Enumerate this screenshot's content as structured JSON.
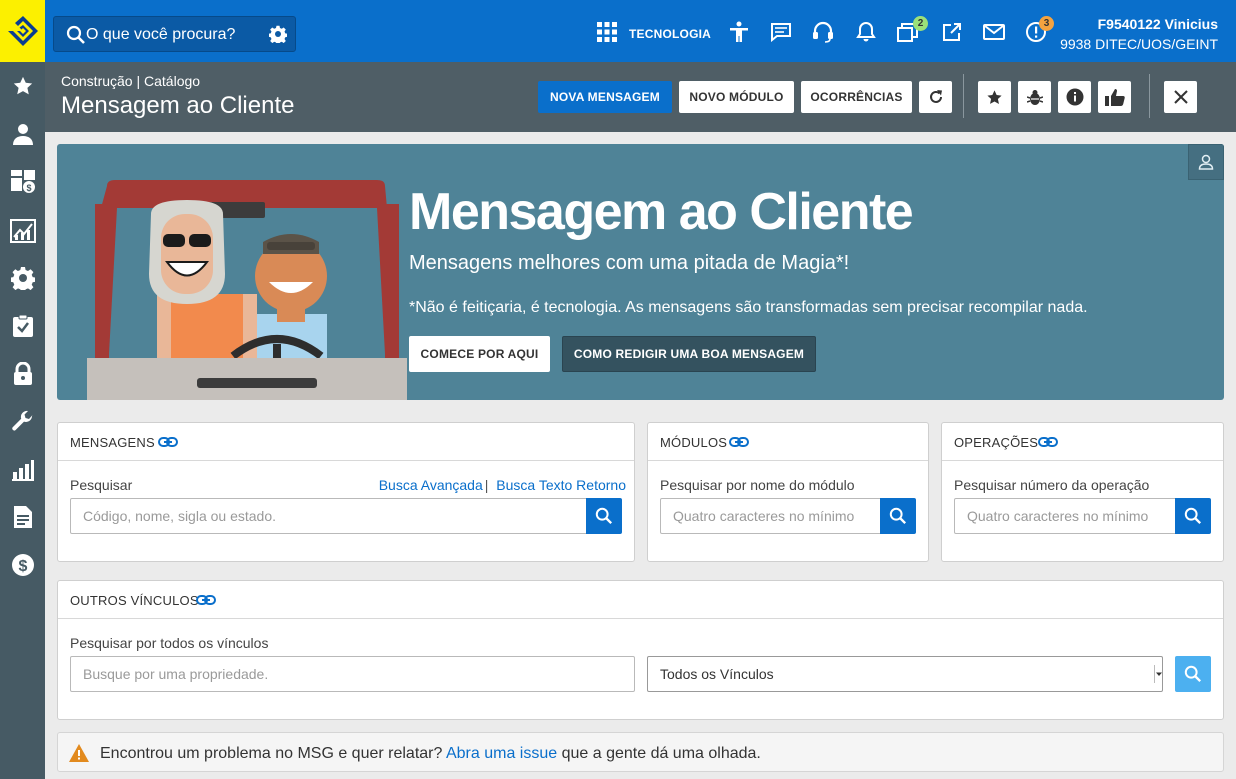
{
  "topbar": {
    "search_placeholder": "O que você procura?",
    "section_label": "TECNOLOGIA",
    "notifications_badge": "2",
    "alerts_badge": "3",
    "user_name": "F9540122 Vinicius",
    "user_unit": "9938 DITEC/UOS/GEINT"
  },
  "header": {
    "breadcrumb": "Construção | Catálogo",
    "title": "Mensagem ao Cliente",
    "buttons": {
      "new_message": "NOVA MENSAGEM",
      "new_module": "NOVO MÓDULO",
      "occurrences": "OCORRÊNCIAS"
    }
  },
  "banner": {
    "title": "Mensagem ao Cliente",
    "subtitle": "Mensagens melhores com uma pitada de Magia*!",
    "note": "*Não é feitiçaria, é tecnologia. As mensagens são transformadas sem precisar recompilar nada.",
    "btn_start": "COMECE POR AQUI",
    "btn_howto": "COMO REDIGIR UMA BOA MENSAGEM"
  },
  "cards": {
    "messages": {
      "title": "MENSAGENS",
      "label": "Pesquisar",
      "advanced_link": "Busca Avançada",
      "separator": "|",
      "text_return_link": "Busca Texto Retorno",
      "placeholder": "Código, nome, sigla ou estado."
    },
    "modules": {
      "title": "MÓDULOS",
      "label": "Pesquisar por nome do módulo",
      "placeholder": "Quatro caracteres no mínimo"
    },
    "operations": {
      "title": "OPERAÇÕES",
      "label": "Pesquisar número da operação",
      "placeholder": "Quatro caracteres no mínimo"
    },
    "links": {
      "title": "OUTROS VÍNCULOS",
      "label": "Pesquisar por todos os vínculos",
      "placeholder": "Busque por uma propriedade.",
      "select_value": "Todos os Vínculos"
    }
  },
  "notice": {
    "text_before": "Encontrou um problema no MSG e quer relatar?",
    "link": "Abra uma issue",
    "text_after": "que a gente dá uma olhada."
  },
  "colors": {
    "topbar": "#0a6fcb",
    "header": "#4f5e66",
    "sidebar": "#465a64",
    "banner": "#4f8397",
    "logo_bg": "#fcf000",
    "badge_green": "#9be07a",
    "badge_orange": "#f4a340"
  },
  "icons": [
    "bb-logo-icon",
    "star-icon",
    "user-icon",
    "dashboard-icon",
    "chart-icon",
    "gear-icon",
    "checklist-icon",
    "lock-icon",
    "wrench-icon",
    "bar-chart-icon",
    "document-icon",
    "dollar-icon",
    "search-icon",
    "settings-icon",
    "apps-grid-icon",
    "accessibility-icon",
    "chat-icon",
    "headset-icon",
    "bell-icon",
    "windows-icon",
    "external-link-icon",
    "mail-icon",
    "alert-icon",
    "refresh-icon",
    "bug-icon",
    "info-icon",
    "thumbs-up-icon",
    "close-icon",
    "link-icon",
    "warning-icon"
  ]
}
